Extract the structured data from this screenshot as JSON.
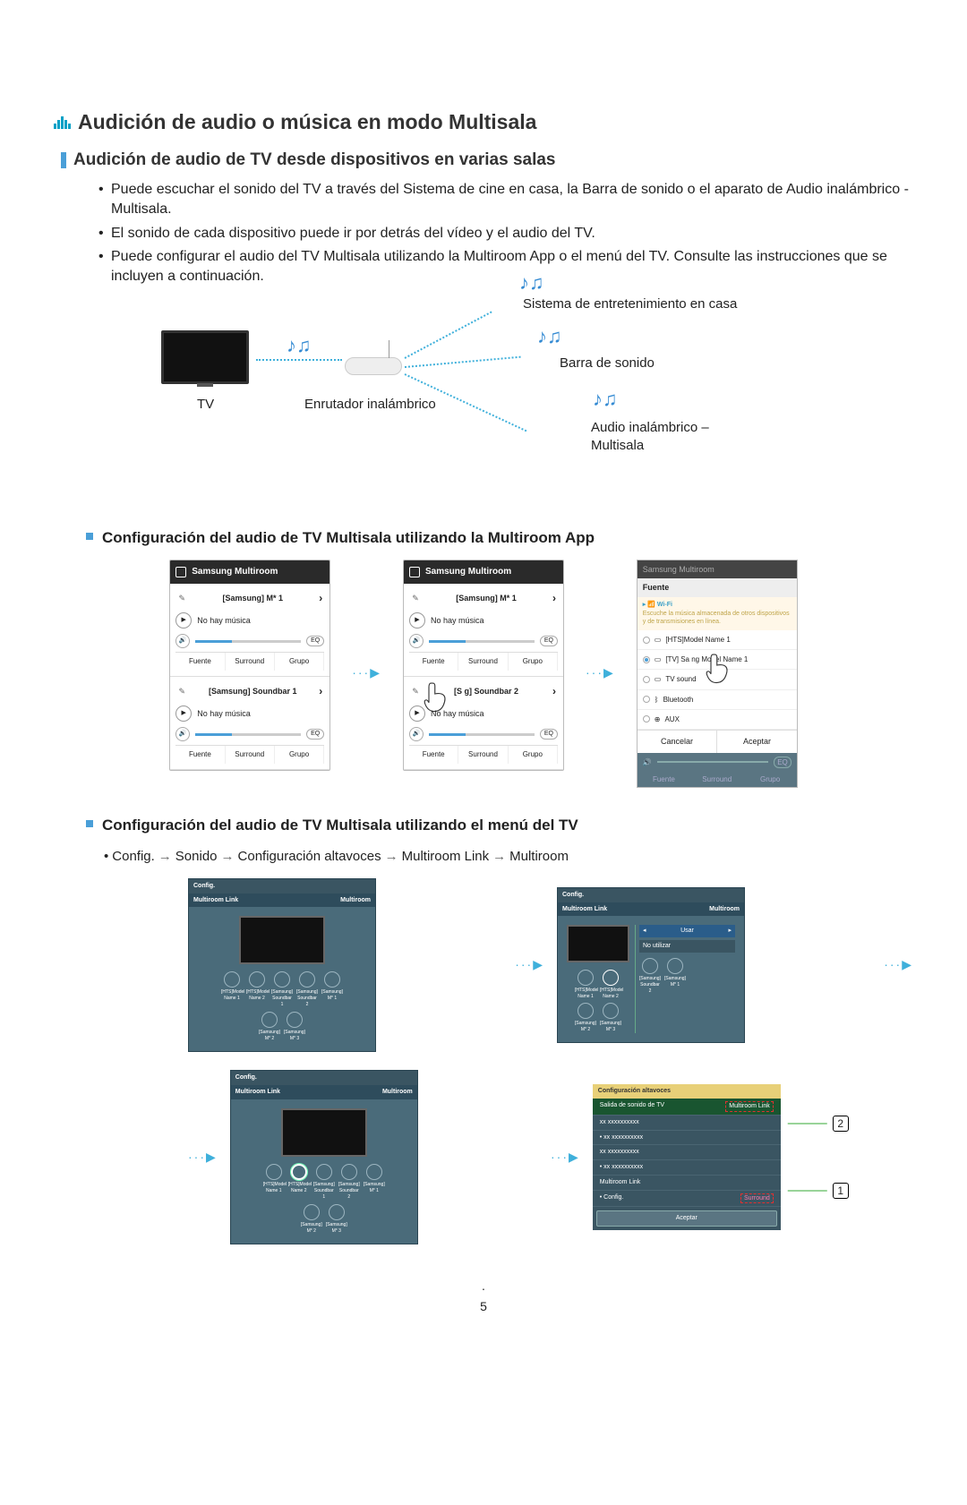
{
  "main_title": "Audición de audio o música en modo Multisala",
  "section1_title": "Audición de audio de TV desde dispositivos en varias salas",
  "bullets": [
    "Puede escuchar el sonido del TV a través del Sistema de cine en casa, la Barra de sonido o el aparato de Audio inalámbrico - Multisala.",
    "El sonido de cada dispositivo puede ir por detrás del vídeo y el audio del TV.",
    "Puede configurar el audio del TV Multisala utilizando la Multiroom App o el menú del TV. Consulte las instrucciones que se incluyen a continuación."
  ],
  "hero_labels": {
    "home_theater": "Sistema de entretenimiento en casa",
    "soundbar": "Barra de sonido",
    "wireless_audio_1": "Audio inalámbrico –",
    "wireless_audio_2": "Multisala",
    "tv": "TV",
    "router": "Enrutador inalámbrico"
  },
  "subsection_app": "Configuración del audio de TV Multisala utilizando la Multiroom App",
  "phone": {
    "app_title": "Samsung Multiroom",
    "dev1": "[Samsung] M* 1",
    "no_music": "No hay música",
    "eq": "EQ",
    "soundbar1": "[Samsung] Soundbar 1",
    "soundbar2_obscured": "[S           g] Soundbar 2",
    "tab_fuente": "Fuente",
    "tab_surround": "Surround",
    "tab_grupo": "Grupo"
  },
  "source_panel": {
    "dim_header": "Samsung Multiroom",
    "fuente": "Fuente",
    "wifi_title": "Wi-Fi",
    "wifi_desc": "Escuche la música almacenada de otros dispositivos y de transmisiones en línea.",
    "hts": "[HTS]Model Name 1",
    "tv_model_partial": "[TV] Sa        ng Model Name 1",
    "tv_sound": "TV sound",
    "bluetooth": "Bluetooth",
    "aux": "AUX",
    "cancelar": "Cancelar",
    "aceptar": "Aceptar"
  },
  "subsection_tv": "Configuración del audio de TV Multisala utilizando el menú del TV",
  "menu_path": [
    "Config.",
    "Sonido",
    "Configuración altavoces",
    "Multiroom Link",
    "Multiroom"
  ],
  "tv_screen": {
    "config": "Config.",
    "mlink": "Multiroom Link",
    "multiroom": "Multiroom",
    "hts_name": "[HTS]Model Name 1",
    "hts_name2": "[HTS]Model Name 2",
    "sb1": "[Samsung] Soundbar 1",
    "sb2": "[Samsung] Soundbar 2",
    "m1": "[Samsung] M* 1",
    "m2": "[Samsung] M* 2",
    "m3": "[Samsung] M* 3",
    "usar": "Usar",
    "no_utilizar": "No utilizar"
  },
  "config_alt": {
    "title": "Configuración altavoces",
    "salida": "Salida de sonido de TV",
    "mlink_val": "Multiroom Link",
    "xx": "xx xxxxxxxxxx",
    "xxx": "• xx xxxxxxxxxx",
    "mlink_label": "Multiroom Link",
    "surround": "Surround",
    "config": "• Config.",
    "aceptar": "Aceptar"
  },
  "callouts": {
    "one": "1",
    "two": "2"
  },
  "page_num": "5"
}
